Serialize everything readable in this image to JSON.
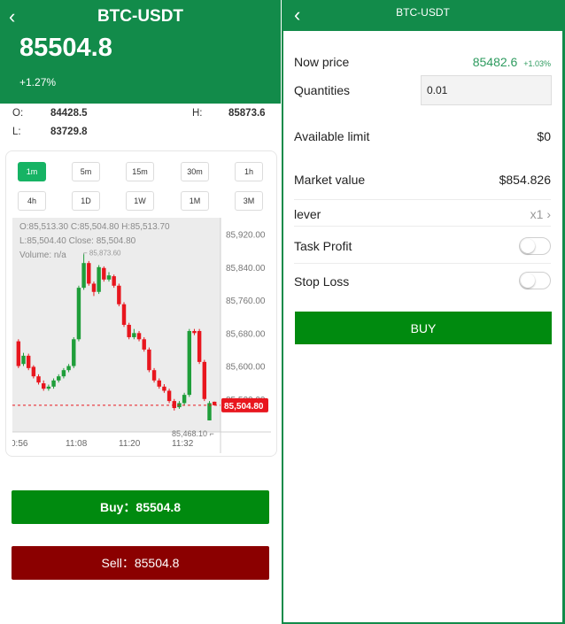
{
  "left": {
    "pair": "BTC-USDT",
    "price": "85504.8",
    "change": "+1.27%",
    "stats": {
      "open_label": "O:",
      "open_value": "84428.5",
      "high_label": "H:",
      "high_value": "85873.6",
      "low_label": "L:",
      "low_value": "83729.8"
    },
    "timeframes": [
      "1m",
      "5m",
      "15m",
      "30m",
      "1h",
      "4h",
      "1D",
      "1W",
      "1M",
      "3M"
    ],
    "active_timeframe": "1m",
    "chart": {
      "tooltip_line1": "O:85,513.30     C:85,504.80     H:85,513.70",
      "tooltip_line2": "L:85,504.40     Close: 85,504.80",
      "tooltip_line3": "Volume:  n/a",
      "high_marker": "85,873.60",
      "low_marker": "85,468.10",
      "current_price_tag": "85,504.80"
    },
    "buy_button": "Buy：85504.8",
    "sell_button": "Sell：85504.8"
  },
  "chart_data": {
    "type": "candlestick",
    "ylim": [
      85440,
      85960
    ],
    "y_ticks": [
      "85,920.00",
      "85,840.00",
      "85,760.00",
      "85,680.00",
      "85,600.00",
      "85,520.00"
    ],
    "y_tick_values": [
      85920,
      85840,
      85760,
      85680,
      85600,
      85520
    ],
    "x_ticks": [
      "0:56",
      "11:08",
      "11:20",
      "11:32"
    ],
    "current_price": 85504.8,
    "candles": [
      {
        "o": 85660,
        "c": 85600,
        "h": 85665,
        "l": 85595
      },
      {
        "o": 85605,
        "c": 85625,
        "h": 85632,
        "l": 85600
      },
      {
        "o": 85625,
        "c": 85595,
        "h": 85630,
        "l": 85590
      },
      {
        "o": 85598,
        "c": 85575,
        "h": 85602,
        "l": 85570
      },
      {
        "o": 85575,
        "c": 85560,
        "h": 85580,
        "l": 85555
      },
      {
        "o": 85558,
        "c": 85545,
        "h": 85565,
        "l": 85540
      },
      {
        "o": 85545,
        "c": 85550,
        "h": 85555,
        "l": 85540
      },
      {
        "o": 85550,
        "c": 85565,
        "h": 85570,
        "l": 85545
      },
      {
        "o": 85565,
        "c": 85575,
        "h": 85580,
        "l": 85560
      },
      {
        "o": 85575,
        "c": 85590,
        "h": 85595,
        "l": 85570
      },
      {
        "o": 85590,
        "c": 85600,
        "h": 85605,
        "l": 85585
      },
      {
        "o": 85600,
        "c": 85665,
        "h": 85670,
        "l": 85595
      },
      {
        "o": 85665,
        "c": 85790,
        "h": 85795,
        "l": 85660
      },
      {
        "o": 85790,
        "c": 85850,
        "h": 85873,
        "l": 85785
      },
      {
        "o": 85850,
        "c": 85800,
        "h": 85855,
        "l": 85795
      },
      {
        "o": 85800,
        "c": 85780,
        "h": 85805,
        "l": 85770
      },
      {
        "o": 85780,
        "c": 85840,
        "h": 85845,
        "l": 85775
      },
      {
        "o": 85838,
        "c": 85810,
        "h": 85842,
        "l": 85805
      },
      {
        "o": 85810,
        "c": 85820,
        "h": 85828,
        "l": 85805
      },
      {
        "o": 85818,
        "c": 85795,
        "h": 85822,
        "l": 85790
      },
      {
        "o": 85795,
        "c": 85750,
        "h": 85800,
        "l": 85745
      },
      {
        "o": 85750,
        "c": 85700,
        "h": 85755,
        "l": 85695
      },
      {
        "o": 85700,
        "c": 85670,
        "h": 85705,
        "l": 85665
      },
      {
        "o": 85670,
        "c": 85680,
        "h": 85690,
        "l": 85665
      },
      {
        "o": 85680,
        "c": 85665,
        "h": 85685,
        "l": 85660
      },
      {
        "o": 85665,
        "c": 85640,
        "h": 85670,
        "l": 85635
      },
      {
        "o": 85640,
        "c": 85590,
        "h": 85645,
        "l": 85585
      },
      {
        "o": 85590,
        "c": 85565,
        "h": 85595,
        "l": 85560
      },
      {
        "o": 85565,
        "c": 85550,
        "h": 85570,
        "l": 85545
      },
      {
        "o": 85550,
        "c": 85540,
        "h": 85556,
        "l": 85535
      },
      {
        "o": 85540,
        "c": 85515,
        "h": 85545,
        "l": 85510
      },
      {
        "o": 85515,
        "c": 85498,
        "h": 85520,
        "l": 85492
      },
      {
        "o": 85500,
        "c": 85510,
        "h": 85515,
        "l": 85496
      },
      {
        "o": 85510,
        "c": 85530,
        "h": 85535,
        "l": 85505
      },
      {
        "o": 85530,
        "c": 85685,
        "h": 85690,
        "l": 85525
      },
      {
        "o": 85685,
        "c": 85680,
        "h": 85690,
        "l": 85675
      },
      {
        "o": 85685,
        "c": 85610,
        "h": 85690,
        "l": 85605
      },
      {
        "o": 85610,
        "c": 85520,
        "h": 85615,
        "l": 85515
      },
      {
        "o": 85468,
        "c": 85510,
        "h": 85515,
        "l": 85468
      },
      {
        "o": 85513.3,
        "c": 85504.8,
        "h": 85513.7,
        "l": 85504.4
      }
    ]
  },
  "right": {
    "pair": "BTC-USDT",
    "now_price_label": "Now price",
    "now_price_value": "85482.6",
    "now_price_change": "+1.03%",
    "quantities_label": "Quantities",
    "quantities_value": "0.01",
    "available_limit_label": "Available limit",
    "available_limit_value": "$0",
    "market_value_label": "Market value",
    "market_value_value": "$854.826",
    "lever_label": "lever",
    "lever_value": "x1",
    "task_profit_label": "Task Profit",
    "task_profit_enabled": false,
    "stop_loss_label": "Stop Loss",
    "stop_loss_enabled": false,
    "buy_button": "BUY"
  },
  "colors": {
    "brand_green": "#128b4a",
    "button_green": "#008a0f",
    "button_red": "#8b0000",
    "candle_up": "#1f9e3a",
    "candle_down": "#e8161e",
    "active_tab": "#16b364"
  }
}
